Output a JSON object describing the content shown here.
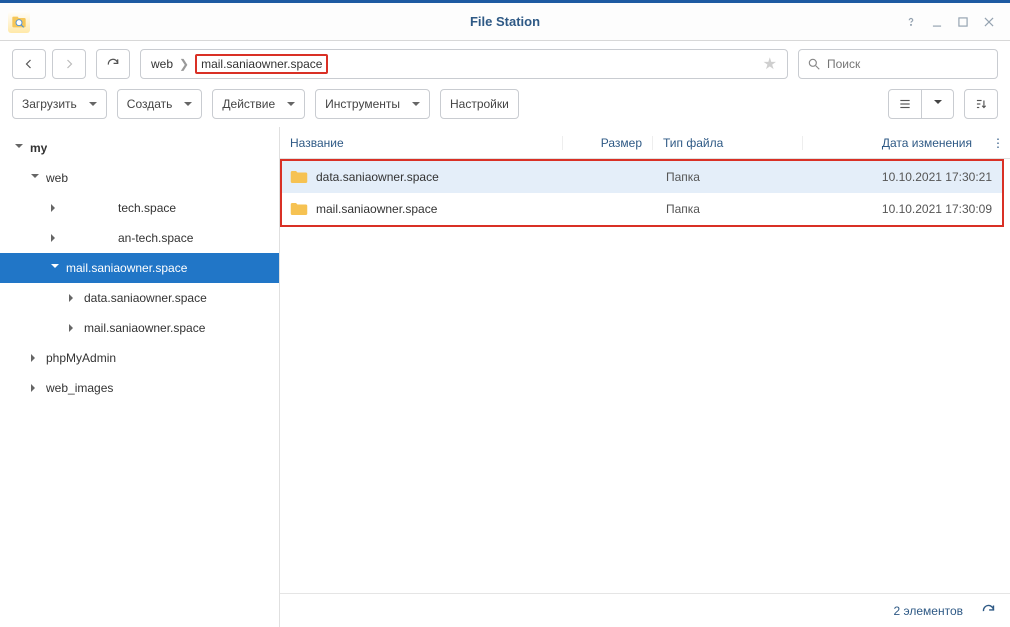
{
  "window": {
    "title": "File Station"
  },
  "nav": {
    "back_icon": "chevron-left",
    "forward_icon": "chevron-right",
    "reload_icon": "reload"
  },
  "breadcrumb": {
    "a": "web",
    "b": "mail.saniaowner.space"
  },
  "search": {
    "placeholder": "Поиск"
  },
  "toolbar": {
    "upload": "Загрузить",
    "create": "Создать",
    "action": "Действие",
    "tools": "Инструменты",
    "settings": "Настройки"
  },
  "tree": {
    "root": "my",
    "n1": "web",
    "n1a": "tech.space",
    "n1b": "an-tech.space",
    "n1c": "mail.saniaowner.space",
    "n1c1": "data.saniaowner.space",
    "n1c2": "mail.saniaowner.space",
    "n2": "phpMyAdmin",
    "n3": "web_images"
  },
  "columns": {
    "name": "Название",
    "size": "Размер",
    "type": "Тип файла",
    "date": "Дата изменения"
  },
  "rows": [
    {
      "name": "data.saniaowner.space",
      "type": "Папка",
      "date": "10.10.2021 17:30:21"
    },
    {
      "name": "mail.saniaowner.space",
      "type": "Папка",
      "date": "10.10.2021 17:30:09"
    }
  ],
  "status": {
    "count": "2 элементов"
  }
}
